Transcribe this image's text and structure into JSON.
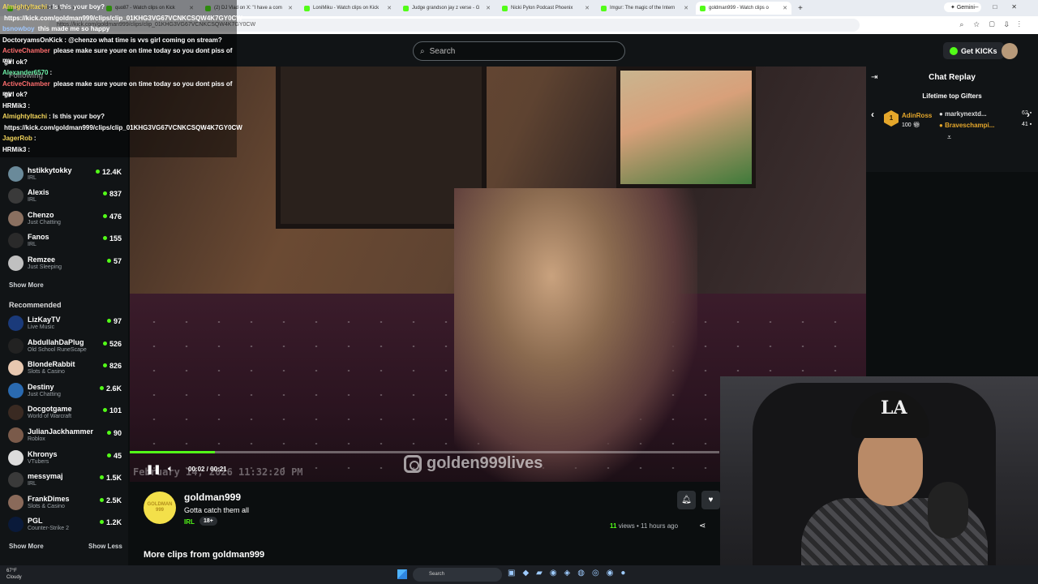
{
  "browser": {
    "tabs": [
      {
        "title": "LoniMiku - Watch clips on Kick",
        "active": false
      },
      {
        "title": "quo87 - Watch clips on Kick",
        "active": false
      },
      {
        "title": "(2) DJ Vlad on X: \"I have a com",
        "active": false
      },
      {
        "title": "LoniMiku - Watch clips on Kick",
        "active": false
      },
      {
        "title": "Judge grandson jay z verse - G",
        "active": false
      },
      {
        "title": "Nicki Pylon Podcast Phoenix",
        "active": false
      },
      {
        "title": "Imgur: The magic of the Intern",
        "active": false
      },
      {
        "title": "goldman999 - Watch clips o",
        "active": true
      }
    ],
    "gemini_label": "Gemini",
    "url": "https://kick.com/goldman999/clips/clip_01KHG3VG67VCNKCSQW4K7GY0CW"
  },
  "site": {
    "search_placeholder": "Search",
    "get_kicks_label": "Get KICKs"
  },
  "chat_overlay": {
    "messages": [
      {
        "user": "AlmightyItachi",
        "text": ": Is this your boy?",
        "color": "#f1d45b"
      },
      {
        "user": "",
        "text": "https://kick.com/goldman999/clips/clip_01KHG3VG67VCNKCSQW4K7GY0CW",
        "color": "#ffffff"
      },
      {
        "user": "bsnowboy",
        "text": " this made me so happy",
        "color": "#9fc7ff"
      },
      {
        "user": "DoctoryamsOnKick",
        "text": ": @chenzo what time is vvs girl coming on stream?",
        "color": "#ffffff"
      },
      {
        "user": "ActiveChamber",
        "text": " please make sure youre on time today so you dont piss of my",
        "color": "#ff6e6e"
      },
      {
        "user": "",
        "text": "girl ok?",
        "color": "#ffffff"
      },
      {
        "user": "Alexander6570",
        "text": ":",
        "color": "#6ef0a8"
      },
      {
        "user": "ActiveChamber",
        "text": " please make sure youre on time today so you dont piss of my",
        "color": "#ff6e6e"
      },
      {
        "user": "",
        "text": "girl ok?",
        "color": "#ffffff"
      },
      {
        "user": "HRMik3",
        "text": ":",
        "color": "#ffffff"
      },
      {
        "user": "AlmightyItachi",
        "text": ": Is this your boy?",
        "color": "#f1d45b"
      },
      {
        "user": "",
        "text": "https://kick.com/goldman999/clips/clip_01KHG3VG67VCNKCSQW4K7GY0CW",
        "color": "#ffffff"
      },
      {
        "user": "JagerRob",
        "text": ":",
        "color": "#f1d45b"
      },
      {
        "user": "HRMik3",
        "text": ":",
        "color": "#ffffff"
      }
    ]
  },
  "sidebar": {
    "following_heading": "Following",
    "following": [
      {
        "name": "hstikkytokky",
        "category": "IRL",
        "viewers": "12.4K",
        "avatar_color": "#6a8a9a"
      },
      {
        "name": "Alexis",
        "category": "IRL",
        "viewers": "837",
        "avatar_color": "#3a3a3a"
      },
      {
        "name": "Chenzo",
        "category": "Just Chatting",
        "viewers": "476",
        "avatar_color": "#8a7060"
      },
      {
        "name": "Fanos",
        "category": "IRL",
        "viewers": "155",
        "avatar_color": "#2a2a2a"
      },
      {
        "name": "Remzee",
        "category": "Just Sleeping",
        "viewers": "57",
        "avatar_color": "#c0c0c0"
      }
    ],
    "show_more": "Show More",
    "recommended_heading": "Recommended",
    "recommended": [
      {
        "name": "LizKayTV",
        "category": "Live Music",
        "viewers": "97",
        "avatar_color": "#1a3a7a"
      },
      {
        "name": "AbdullahDaPlug",
        "category": "Old School RuneScape",
        "viewers": "526",
        "avatar_color": "#222"
      },
      {
        "name": "BlondeRabbit",
        "category": "Slots & Casino",
        "viewers": "826",
        "avatar_color": "#e8c8b0"
      },
      {
        "name": "Destiny",
        "category": "Just Chatting",
        "viewers": "2.6K",
        "avatar_color": "#2a6ab0"
      },
      {
        "name": "Docgotgame",
        "category": "World of Warcraft",
        "viewers": "101",
        "avatar_color": "#3a2a22"
      },
      {
        "name": "JulianJackhammer",
        "category": "Roblox",
        "viewers": "90",
        "avatar_color": "#7a5a4a"
      },
      {
        "name": "Khronys",
        "category": "VTubers",
        "viewers": "45",
        "avatar_color": "#dcdcdc"
      },
      {
        "name": "messymaj",
        "category": "IRL",
        "viewers": "1.5K",
        "avatar_color": "#3a3a3a"
      },
      {
        "name": "FrankDimes",
        "category": "Slots & Casino",
        "viewers": "2.5K",
        "avatar_color": "#8a6a5a"
      },
      {
        "name": "PGL",
        "category": "Counter-Strike 2",
        "viewers": "1.2K",
        "avatar_color": "#0a1a3a"
      }
    ],
    "show_more_2": "Show More",
    "show_less": "Show Less"
  },
  "player": {
    "progress": 0.145,
    "time": "00:02 / 00:21",
    "timestamp_overlay": "February 14, 2026 11:32:20 PM",
    "watermark": "golden999lives"
  },
  "clip_info": {
    "logo_text": "GOLDMAN 999",
    "channel": "goldman999",
    "title": "Gotta catch them all",
    "category": "IRL",
    "tag": "18+",
    "views_count": "11",
    "views_label": "views",
    "age": "11 hours ago",
    "more_clips": "More clips from goldman999"
  },
  "chat_replay": {
    "title": "Chat Replay",
    "subtitle": "Lifetime top Gifters",
    "gifters": [
      {
        "rank": "1",
        "name": "AdinRoss",
        "count": "100"
      },
      {
        "name": "markynextd...",
        "count": "62"
      },
      {
        "name": "Braveschampi...",
        "count": "41"
      }
    ]
  },
  "taskbar": {
    "temp": "67°F",
    "weather": "Cloudy",
    "search_label": "Search"
  },
  "colors": {
    "accent": "#53fc18",
    "gold": "#e5a72b"
  }
}
